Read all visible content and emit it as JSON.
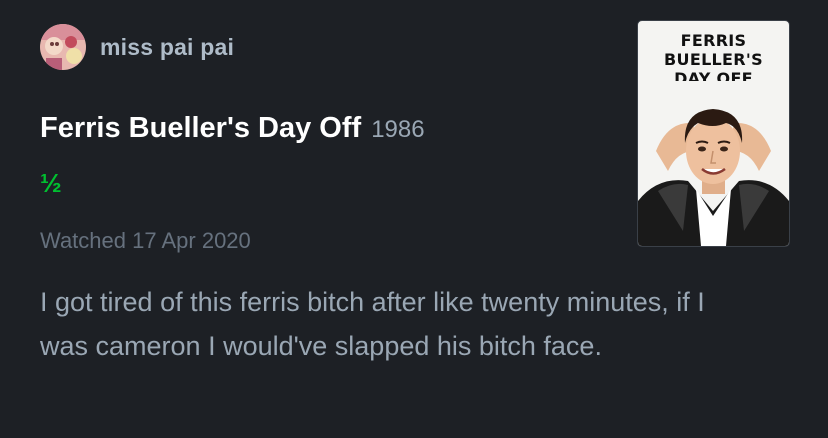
{
  "user": {
    "name": "miss pai pai",
    "avatar_icon": "avatar-icon"
  },
  "film": {
    "title": "Ferris Bueller's Day Off",
    "year": "1986",
    "rating": "½",
    "rating_value": 0.5,
    "watched": "Watched 17 Apr 2020",
    "poster_text": "FERRIS\nBUELLER'S\nDAY OFF"
  },
  "review": {
    "text": "I got tired of this ferris bitch after like twenty minutes, if I was cameron I would've slapped his bitch face."
  },
  "colors": {
    "background": "#1d2025",
    "rating_green": "#00c030",
    "username": "#aebbc8",
    "muted": "#9aa7b4",
    "date": "#66717e"
  }
}
